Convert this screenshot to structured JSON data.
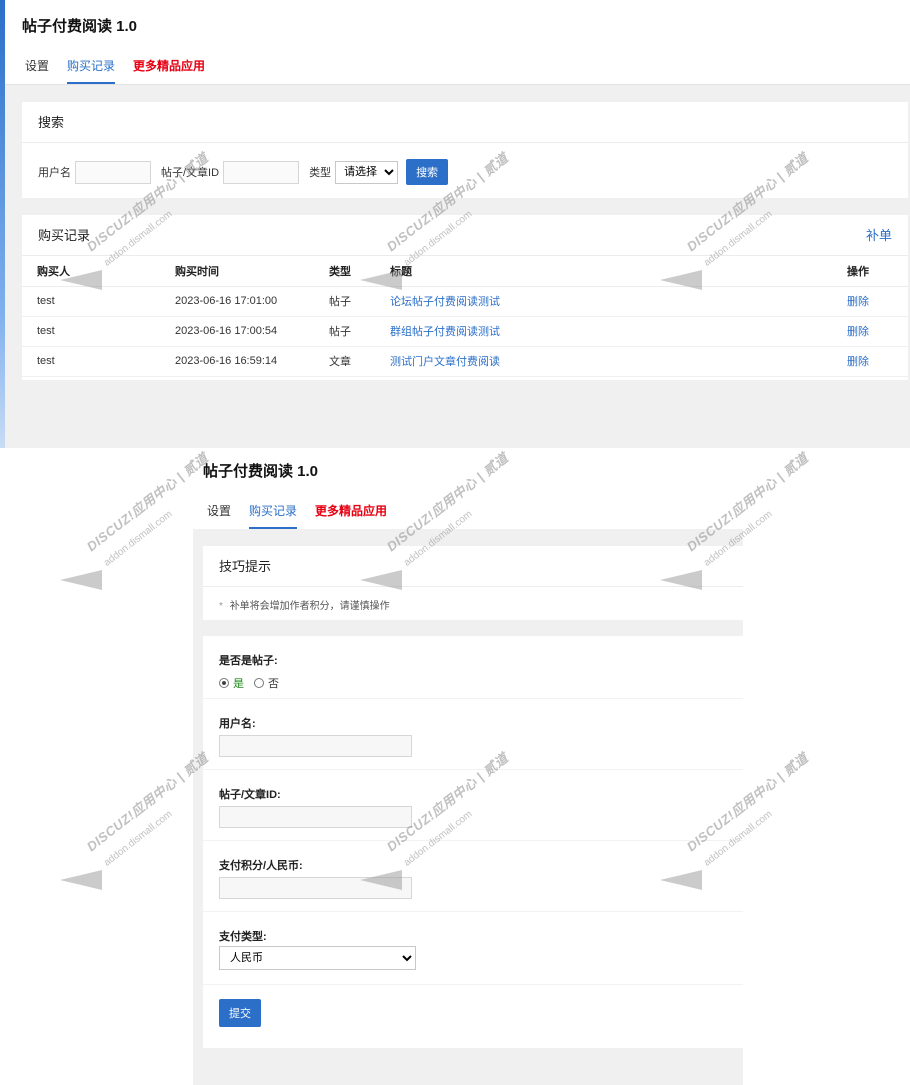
{
  "app_title": "帖子付费阅读 1.0",
  "tabs": [
    {
      "label": "设置"
    },
    {
      "label": "购买记录"
    },
    {
      "label": "更多精品应用"
    }
  ],
  "search": {
    "title": "搜索",
    "username_label": "用户名",
    "id_label": "帖子/文章ID",
    "type_label": "类型",
    "type_selected": "请选择",
    "button": "搜索"
  },
  "records": {
    "title": "购买记录",
    "supplement_link": "补单",
    "columns": [
      "购买人",
      "购买时间",
      "类型",
      "标题",
      "操作"
    ],
    "rows": [
      {
        "buyer": "test",
        "time": "2023-06-16 17:01:00",
        "type": "帖子",
        "title": "论坛帖子付费阅读测试",
        "action": "删除"
      },
      {
        "buyer": "test",
        "time": "2023-06-16 17:00:54",
        "type": "帖子",
        "title": "群组帖子付费阅读测试",
        "action": "删除"
      },
      {
        "buyer": "test",
        "time": "2023-06-16 16:59:14",
        "type": "文章",
        "title": "测试门户文章付费阅读",
        "action": "删除"
      }
    ]
  },
  "tips": {
    "title": "技巧提示",
    "items": [
      "补单将会增加作者积分，请谨慎操作"
    ]
  },
  "form": {
    "is_thread_label": "是否是帖子:",
    "radio_yes": "是",
    "radio_no": "否",
    "username_label": "用户名:",
    "id_label": "帖子/文章ID:",
    "amount_label": "支付积分/人民币:",
    "pay_type_label": "支付类型:",
    "pay_type_selected": "人民币",
    "submit": "提交"
  },
  "watermark": {
    "brand": "DISCUZ!应用中心 | 贰道",
    "domain": "addon.dismall.com"
  }
}
